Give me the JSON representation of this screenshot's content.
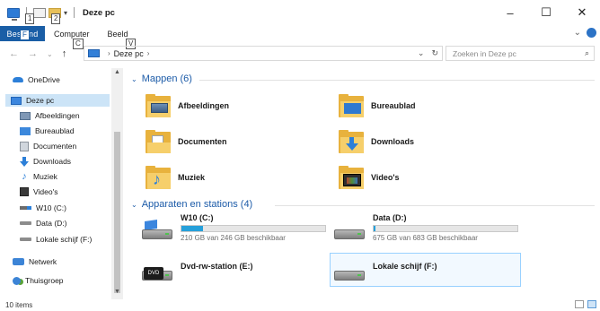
{
  "window": {
    "title": "Deze pc",
    "controls": {
      "minimize": "–",
      "maximize": "☐",
      "close": "✕"
    }
  },
  "keytips": [
    "1",
    "2",
    "C",
    "V"
  ],
  "ribbon": {
    "file_tab": "Bestand",
    "file_tab_keytip": "F",
    "tabs": [
      "Computer",
      "Beeld"
    ]
  },
  "address": {
    "back": "←",
    "forward": "→",
    "recent": "⌄",
    "up": "↑",
    "path": "Deze pc",
    "path_chevron": "›",
    "dropdown": "⌄",
    "refresh": "↻"
  },
  "search": {
    "placeholder": "Zoeken in Deze pc",
    "icon": "search-icon"
  },
  "nav": {
    "items": [
      {
        "label": "OneDrive",
        "icon": "cloud-icon"
      },
      {
        "label": "Deze pc",
        "icon": "computer-icon",
        "selected": true
      },
      {
        "label": "Afbeeldingen",
        "icon": "pictures-icon"
      },
      {
        "label": "Bureaublad",
        "icon": "desktop-icon"
      },
      {
        "label": "Documenten",
        "icon": "documents-icon"
      },
      {
        "label": "Downloads",
        "icon": "downloads-icon"
      },
      {
        "label": "Muziek",
        "icon": "music-icon"
      },
      {
        "label": "Video's",
        "icon": "videos-icon"
      },
      {
        "label": "W10 (C:)",
        "icon": "drive-icon"
      },
      {
        "label": "Data (D:)",
        "icon": "drive-icon"
      },
      {
        "label": "Lokale schijf (F:)",
        "icon": "drive-icon"
      },
      {
        "label": "Netwerk",
        "icon": "network-icon"
      },
      {
        "label": "Thuisgroep",
        "icon": "homegroup-icon"
      }
    ]
  },
  "groups": {
    "folders": {
      "title": "Mappen (6)",
      "items": [
        {
          "label": "Afbeeldingen",
          "icon": "pictures-folder-icon"
        },
        {
          "label": "Bureaublad",
          "icon": "desktop-folder-icon"
        },
        {
          "label": "Documenten",
          "icon": "documents-folder-icon"
        },
        {
          "label": "Downloads",
          "icon": "downloads-folder-icon"
        },
        {
          "label": "Muziek",
          "icon": "music-folder-icon"
        },
        {
          "label": "Video's",
          "icon": "videos-folder-icon"
        }
      ]
    },
    "devices": {
      "title": "Apparaten en stations (4)",
      "items": [
        {
          "label": "W10 (C:)",
          "free": "210 GB van 246 GB beschikbaar",
          "used_fraction": 0.15,
          "icon": "windows-drive-icon"
        },
        {
          "label": "Data (D:)",
          "free": "675 GB van 683 GB beschikbaar",
          "used_fraction": 0.012,
          "icon": "hard-drive-icon"
        },
        {
          "label": "Dvd-rw-station (E:)",
          "icon": "dvd-drive-icon",
          "badge": "DVD"
        },
        {
          "label": "Lokale schijf (F:)",
          "icon": "hard-drive-icon"
        }
      ]
    }
  },
  "status": {
    "count": "10 items"
  }
}
